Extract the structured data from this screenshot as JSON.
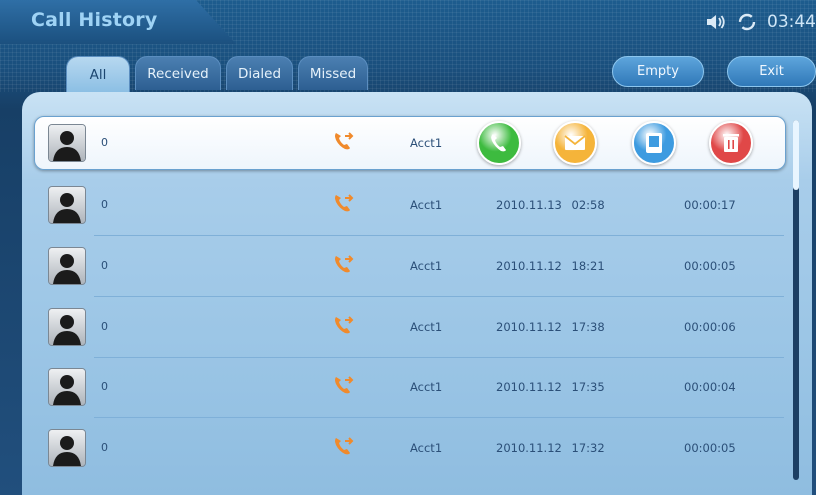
{
  "header": {
    "title": "Call History",
    "clock": "03:44",
    "status_icons": [
      "speaker-icon",
      "sync-icon"
    ]
  },
  "tabs": [
    {
      "label": "All",
      "active": true
    },
    {
      "label": "Received",
      "active": false
    },
    {
      "label": "Dialed",
      "active": false
    },
    {
      "label": "Missed",
      "active": false
    }
  ],
  "buttons": {
    "empty": "Empty",
    "exit": "Exit"
  },
  "actions": [
    "call-icon",
    "message-icon",
    "contact-icon",
    "delete-icon"
  ],
  "calls": [
    {
      "number": "0",
      "type": "dialed-call-icon",
      "account": "Acct1",
      "date": "",
      "duration": "",
      "selected": true
    },
    {
      "number": "0",
      "type": "dialed-call-icon",
      "account": "Acct1",
      "date": "2010.11.13 02:58",
      "duration": "00:00:17"
    },
    {
      "number": "0",
      "type": "dialed-call-icon",
      "account": "Acct1",
      "date": "2010.11.12 18:21",
      "duration": "00:00:05"
    },
    {
      "number": "0",
      "type": "dialed-call-icon",
      "account": "Acct1",
      "date": "2010.11.12 17:38",
      "duration": "00:00:06"
    },
    {
      "number": "0",
      "type": "dialed-call-icon",
      "account": "Acct1",
      "date": "2010.11.12 17:35",
      "duration": "00:00:04"
    },
    {
      "number": "0",
      "type": "dialed-call-icon",
      "account": "Acct1",
      "date": "2010.11.12 17:32",
      "duration": "00:00:05"
    }
  ],
  "colors": {
    "call": "#3dbb3f",
    "message": "#f5b43a",
    "contact": "#3d9be0",
    "delete": "#e04848",
    "call_type": "#f08a2c"
  }
}
